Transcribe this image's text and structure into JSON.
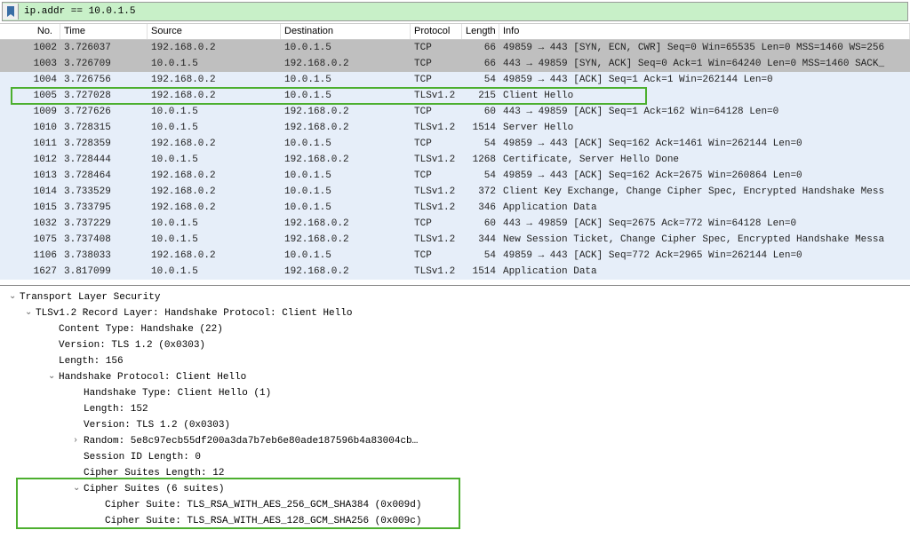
{
  "filter": {
    "value": "ip.addr == 10.0.1.5"
  },
  "columns": [
    "No.",
    "Time",
    "Source",
    "Destination",
    "Protocol",
    "Length",
    "Info"
  ],
  "packets": [
    {
      "no": "1002",
      "time": "3.726037",
      "src": "192.168.0.2",
      "dst": "10.0.1.5",
      "proto": "TCP",
      "len": "66",
      "info": "49859 → 443 [SYN, ECN, CWR] Seq=0 Win=65535 Len=0 MSS=1460 WS=256",
      "cls": "gray"
    },
    {
      "no": "1003",
      "time": "3.726709",
      "src": "10.0.1.5",
      "dst": "192.168.0.2",
      "proto": "TCP",
      "len": "66",
      "info": "443 → 49859 [SYN, ACK] Seq=0 Ack=1 Win=64240 Len=0 MSS=1460 SACK_",
      "cls": "gray"
    },
    {
      "no": "1004",
      "time": "3.726756",
      "src": "192.168.0.2",
      "dst": "10.0.1.5",
      "proto": "TCP",
      "len": "54",
      "info": "49859 → 443 [ACK] Seq=1 Ack=1 Win=262144 Len=0",
      "cls": "blue"
    },
    {
      "no": "1005",
      "time": "3.727028",
      "src": "192.168.0.2",
      "dst": "10.0.1.5",
      "proto": "TLSv1.2",
      "len": "215",
      "info": "Client Hello",
      "cls": "blue"
    },
    {
      "no": "1009",
      "time": "3.727626",
      "src": "10.0.1.5",
      "dst": "192.168.0.2",
      "proto": "TCP",
      "len": "60",
      "info": "443 → 49859 [ACK] Seq=1 Ack=162 Win=64128 Len=0",
      "cls": "blue"
    },
    {
      "no": "1010",
      "time": "3.728315",
      "src": "10.0.1.5",
      "dst": "192.168.0.2",
      "proto": "TLSv1.2",
      "len": "1514",
      "info": "Server Hello",
      "cls": "blue"
    },
    {
      "no": "1011",
      "time": "3.728359",
      "src": "192.168.0.2",
      "dst": "10.0.1.5",
      "proto": "TCP",
      "len": "54",
      "info": "49859 → 443 [ACK] Seq=162 Ack=1461 Win=262144 Len=0",
      "cls": "blue"
    },
    {
      "no": "1012",
      "time": "3.728444",
      "src": "10.0.1.5",
      "dst": "192.168.0.2",
      "proto": "TLSv1.2",
      "len": "1268",
      "info": "Certificate, Server Hello Done",
      "cls": "blue"
    },
    {
      "no": "1013",
      "time": "3.728464",
      "src": "192.168.0.2",
      "dst": "10.0.1.5",
      "proto": "TCP",
      "len": "54",
      "info": "49859 → 443 [ACK] Seq=162 Ack=2675 Win=260864 Len=0",
      "cls": "blue"
    },
    {
      "no": "1014",
      "time": "3.733529",
      "src": "192.168.0.2",
      "dst": "10.0.1.5",
      "proto": "TLSv1.2",
      "len": "372",
      "info": "Client Key Exchange, Change Cipher Spec, Encrypted Handshake Mess",
      "cls": "blue"
    },
    {
      "no": "1015",
      "time": "3.733795",
      "src": "192.168.0.2",
      "dst": "10.0.1.5",
      "proto": "TLSv1.2",
      "len": "346",
      "info": "Application Data",
      "cls": "blue"
    },
    {
      "no": "1032",
      "time": "3.737229",
      "src": "10.0.1.5",
      "dst": "192.168.0.2",
      "proto": "TCP",
      "len": "60",
      "info": "443 → 49859 [ACK] Seq=2675 Ack=772 Win=64128 Len=0",
      "cls": "blue"
    },
    {
      "no": "1075",
      "time": "3.737408",
      "src": "10.0.1.5",
      "dst": "192.168.0.2",
      "proto": "TLSv1.2",
      "len": "344",
      "info": "New Session Ticket, Change Cipher Spec, Encrypted Handshake Messa",
      "cls": "blue"
    },
    {
      "no": "1106",
      "time": "3.738033",
      "src": "192.168.0.2",
      "dst": "10.0.1.5",
      "proto": "TCP",
      "len": "54",
      "info": "49859 → 443 [ACK] Seq=772 Ack=2965 Win=262144 Len=0",
      "cls": "blue"
    },
    {
      "no": "1627",
      "time": "3.817099",
      "src": "10.0.1.5",
      "dst": "192.168.0.2",
      "proto": "TLSv1.2",
      "len": "1514",
      "info": "Application Data",
      "cls": "blue"
    }
  ],
  "details": {
    "root": "Transport Layer Security",
    "record": "TLSv1.2 Record Layer: Handshake Protocol: Client Hello",
    "content_type": "Content Type: Handshake (22)",
    "version1": "Version: TLS 1.2 (0x0303)",
    "length1": "Length: 156",
    "handshake_proto": "Handshake Protocol: Client Hello",
    "handshake_type": "Handshake Type: Client Hello (1)",
    "length2": "Length: 152",
    "version2": "Version: TLS 1.2 (0x0303)",
    "random": "Random: 5e8c97ecb55df200a3da7b7eb6e80ade187596b4a83004cb…",
    "session_id_len": "Session ID Length: 0",
    "cipher_len": "Cipher Suites Length: 12",
    "cipher_suites": "Cipher Suites (6 suites)",
    "cs1": "Cipher Suite: TLS_RSA_WITH_AES_256_GCM_SHA384 (0x009d)",
    "cs2": "Cipher Suite: TLS_RSA_WITH_AES_128_GCM_SHA256 (0x009c)"
  }
}
